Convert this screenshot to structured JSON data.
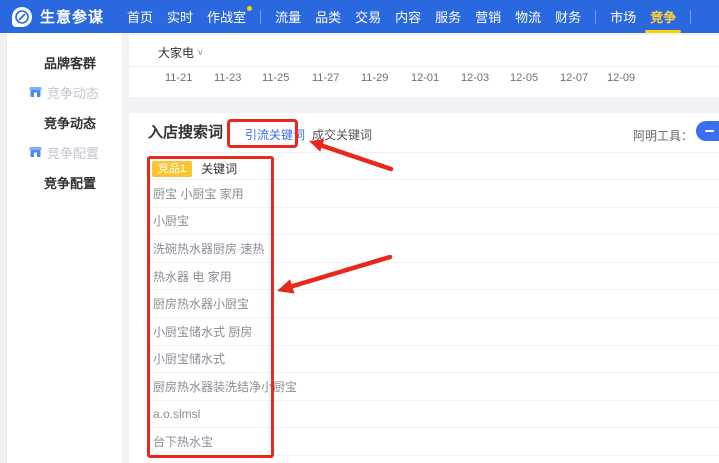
{
  "nav": {
    "brand": "生意参谋",
    "items": [
      {
        "label": "首页"
      },
      {
        "label": "实时"
      },
      {
        "label": "作战室",
        "dot": true
      },
      {
        "label": "流量"
      },
      {
        "label": "品类"
      },
      {
        "label": "交易"
      },
      {
        "label": "内容"
      },
      {
        "label": "服务"
      },
      {
        "label": "营销"
      },
      {
        "label": "物流"
      },
      {
        "label": "财务"
      },
      {
        "label": "市场"
      },
      {
        "label": "竞争",
        "active": true
      }
    ]
  },
  "sidebar": {
    "items": [
      {
        "label": "品牌客群",
        "type": "header"
      },
      {
        "label": "竞争动态",
        "type": "link",
        "icon": "shop-icon"
      },
      {
        "label": "竞争动态",
        "type": "header"
      },
      {
        "label": "竞争配置",
        "type": "link",
        "icon": "shop-icon"
      },
      {
        "label": "竞争配置",
        "type": "header"
      }
    ]
  },
  "filters": {
    "category": "大家电",
    "dates": [
      "11-21",
      "11-23",
      "11-25",
      "11-27",
      "11-29",
      "12-01",
      "12-03",
      "12-05",
      "12-07",
      "12-09"
    ]
  },
  "content": {
    "section_title": "入店搜索词",
    "tabs": [
      {
        "label": "引流关键词",
        "active": true
      },
      {
        "label": "成交关键词",
        "active": false
      }
    ],
    "tool_label": "阿明工具：",
    "table": {
      "badge": "竞品1",
      "column_header": "关键词",
      "rows": [
        "厨宝 小厨宝 家用",
        "小厨宝",
        "洗碗热水器厨房 速热",
        "热水器 电 家用",
        "厨房热水器小厨宝",
        "小厨宝储水式 厨房",
        "小厨宝储水式",
        "厨房热水器装洗结净小厨宝",
        "a.o.slmsl",
        "台下热水宝"
      ]
    }
  },
  "colors": {
    "nav_blue": "#2a68e0",
    "accent_yellow": "#ffd100",
    "annotation_red": "#e9291d",
    "tab_blue": "#3a6ff2",
    "badge_orange": "#fbc531"
  }
}
